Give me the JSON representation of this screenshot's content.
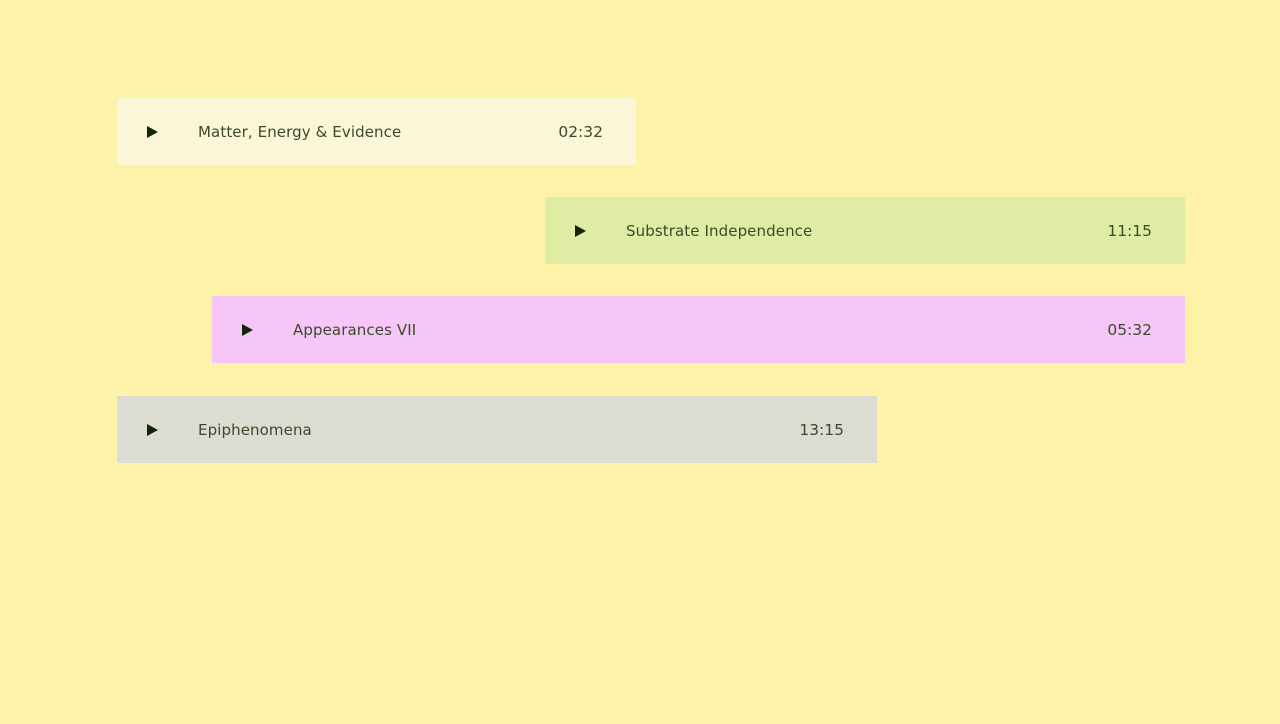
{
  "tracks": [
    {
      "title": "Matter, Energy & Evidence",
      "duration": "02:32",
      "color": "#fcf6d9",
      "icon": "play-icon"
    },
    {
      "title": "Substrate Independence",
      "duration": "11:15",
      "color": "#dfeda4",
      "icon": "play-icon"
    },
    {
      "title": "Appearances VII",
      "duration": "05:32",
      "color": "#f6c6f8",
      "icon": "play-icon"
    },
    {
      "title": "Epiphenomena",
      "duration": "13:15",
      "color": "#dcdcd2",
      "icon": "play-icon"
    }
  ],
  "background_color": "#fdf2a8",
  "icon_color": "#142408"
}
